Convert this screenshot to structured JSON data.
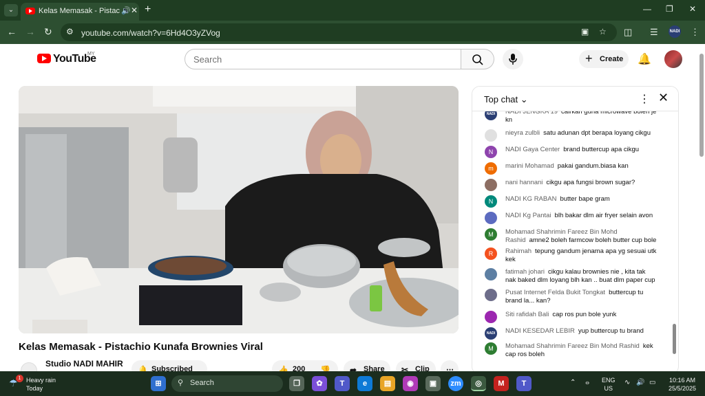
{
  "browser": {
    "tab_title": "Kelas Memasak - Pistachio K",
    "url": "youtube.com/watch?v=6Hd4O3yZVog",
    "profile_initials": "NADI",
    "accent": "#1f3d22"
  },
  "header": {
    "logo_text": "YouTube",
    "country": "MY",
    "search_placeholder": "Search",
    "create_label": "Create"
  },
  "video": {
    "title": "Kelas Memasak - Pistachio Kunafa Brownies Viral",
    "channel": "Studio NADI MAHIR",
    "subscribed_label": "Subscribed",
    "like_count": "200",
    "share_label": "Share",
    "clip_label": "Clip"
  },
  "chat": {
    "mode_label": "Top chat",
    "messages": [
      {
        "author": "NADI JENGKA 19",
        "text": "cairkan guna microwave boleh je kn",
        "avatar_color": "#2a3e73",
        "avatar_text": "NADI"
      },
      {
        "author": "nieyra zulbli",
        "text": "satu adunan dpt berapa loyang cikgu",
        "avatar_color": "#e0e0e0",
        "avatar_text": ""
      },
      {
        "author": "NADI Gaya Center",
        "text": "brand buttercup apa cikgu",
        "avatar_color": "#8e44ad",
        "avatar_text": "N"
      },
      {
        "author": "marini Mohamad",
        "text": "pakai gandum.biasa kan",
        "avatar_color": "#ef6c00",
        "avatar_text": "m"
      },
      {
        "author": "nani hannani",
        "text": "cikgu apa fungsi brown sugar?",
        "avatar_color": "#8d6e63",
        "avatar_text": ""
      },
      {
        "author": "NADI KG RABAN",
        "text": "butter bape gram",
        "avatar_color": "#00897b",
        "avatar_text": "N"
      },
      {
        "author": "NADI Kg Pantai",
        "text": "blh bakar dlm air fryer selain avon",
        "avatar_color": "#5c6bc0",
        "avatar_text": ""
      },
      {
        "author": "Mohamad Shahrimin Fareez Bin Mohd Rashid",
        "text": "amne2 boleh farmcow boleh butter cup bole",
        "avatar_color": "#2e7d32",
        "avatar_text": "M"
      },
      {
        "author": "Rahimah",
        "text": "tepung gandum jenama apa yg sesuai utk kek",
        "avatar_color": "#f4511e",
        "avatar_text": "R"
      },
      {
        "author": "fatimah johari",
        "text": "cikgu kalau brownies nie , kita tak nak baked dlm loyang blh kan .. buat dlm paper cup",
        "avatar_color": "#5d7fa3",
        "avatar_text": ""
      },
      {
        "author": "Pusat Internet Felda Bukit Tongkat",
        "text": "buttercup tu brand la... kan?",
        "avatar_color": "#6d6d8a",
        "avatar_text": ""
      },
      {
        "author": "Siti rafidah Bali",
        "text": "cap ros pun bole yunk",
        "avatar_color": "#9c27b0",
        "avatar_text": ""
      },
      {
        "author": "NADI KESEDAR LEBIR",
        "text": "yup buttercup tu brand",
        "avatar_color": "#2a3e73",
        "avatar_text": "NADI"
      },
      {
        "author": "Mohamad Shahrimin Fareez Bin Mohd Rashid",
        "text": "kek cap ros boleh",
        "avatar_color": "#2e7d32",
        "avatar_text": "M"
      }
    ]
  },
  "taskbar": {
    "weather_title": "Heavy rain",
    "weather_sub": "Today",
    "weather_badge": "1",
    "search_label": "Search",
    "lang_top": "ENG",
    "lang_bottom": "US",
    "time": "10:16 AM",
    "date": "25/5/2025"
  }
}
